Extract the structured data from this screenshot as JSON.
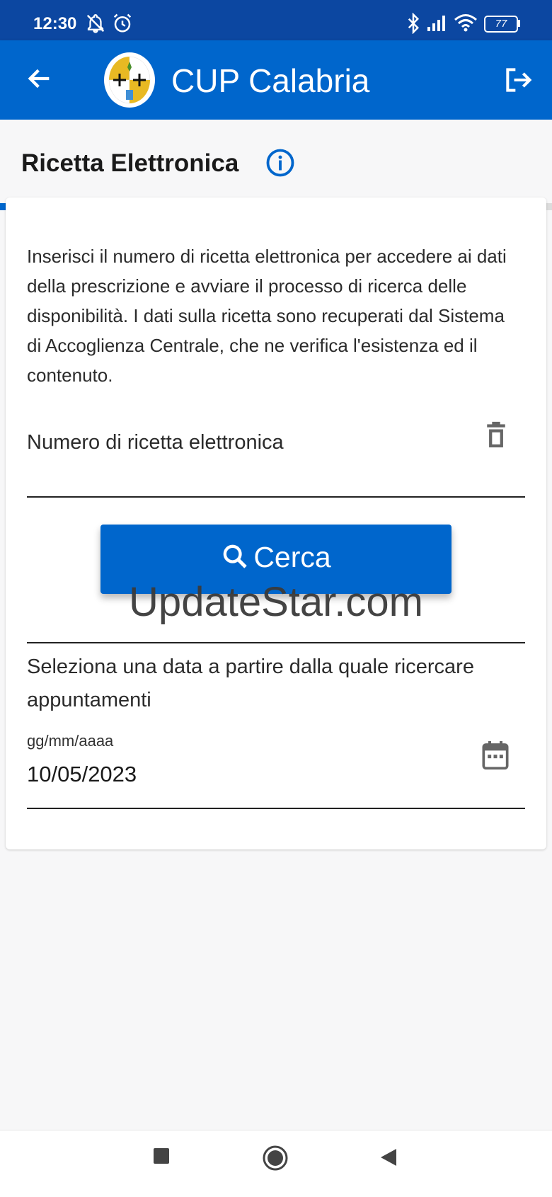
{
  "status_bar": {
    "time": "12:30",
    "battery": "77",
    "icons": [
      "notifications-off-icon",
      "alarm-icon",
      "bluetooth-icon",
      "signal-icon",
      "wifi-icon",
      "battery-icon"
    ]
  },
  "app_bar": {
    "title": "CUP Calabria",
    "color": "#0066cc",
    "icons": [
      "back-arrow-icon",
      "region-logo",
      "logout-icon"
    ]
  },
  "page": {
    "title": "Ricetta Elettronica",
    "progress_fraction": 0.25
  },
  "form": {
    "description": "Inserisci il numero di ricetta elettronica per accedere ai dati della prescrizione e avviare il processo di ricerca delle disponibilità. I dati sulla ricetta sono recuperati dal Sistema di Accoglienza Centrale, che ne verifica l'esistenza ed il contenuto.",
    "prescription_field_label": "Numero di ricetta elettronica",
    "search_button_label": "Cerca",
    "date_section_label": "Seleziona una data a partire dalla quale ricercare appuntamenti",
    "date_format_hint": "gg/mm/aaaa",
    "date_value": "10/05/2023"
  },
  "watermark": "UpdateStar.com",
  "nav_bar": {
    "icons": [
      "recent-apps-icon",
      "home-icon",
      "back-icon"
    ]
  }
}
